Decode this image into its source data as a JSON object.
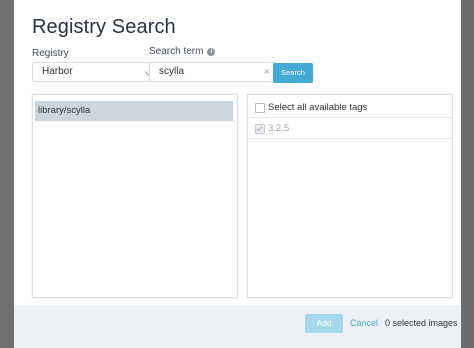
{
  "dialog": {
    "title": "Registry Search"
  },
  "registry": {
    "label": "Registry",
    "value": "Harbor"
  },
  "search_term": {
    "label": "Search term",
    "value": "scylla",
    "clear_glyph": "×",
    "info_glyph": "i"
  },
  "search_button": {
    "label": "Search"
  },
  "repositories": [
    {
      "name": "library/scylla",
      "selected": true
    }
  ],
  "tags": {
    "select_all_label": "Select all available tags",
    "items": [
      {
        "name": "3.2.5",
        "checked": true,
        "disabled": true
      }
    ]
  },
  "footer": {
    "add_label": "Add",
    "cancel_label": "Cancel",
    "selected_count": "0 selected images"
  },
  "colors": {
    "accent": "#43a9d5",
    "accent_disabled": "#a7d9ee",
    "selected_row": "#cdd5df",
    "backdrop": "#6e6e6e"
  }
}
